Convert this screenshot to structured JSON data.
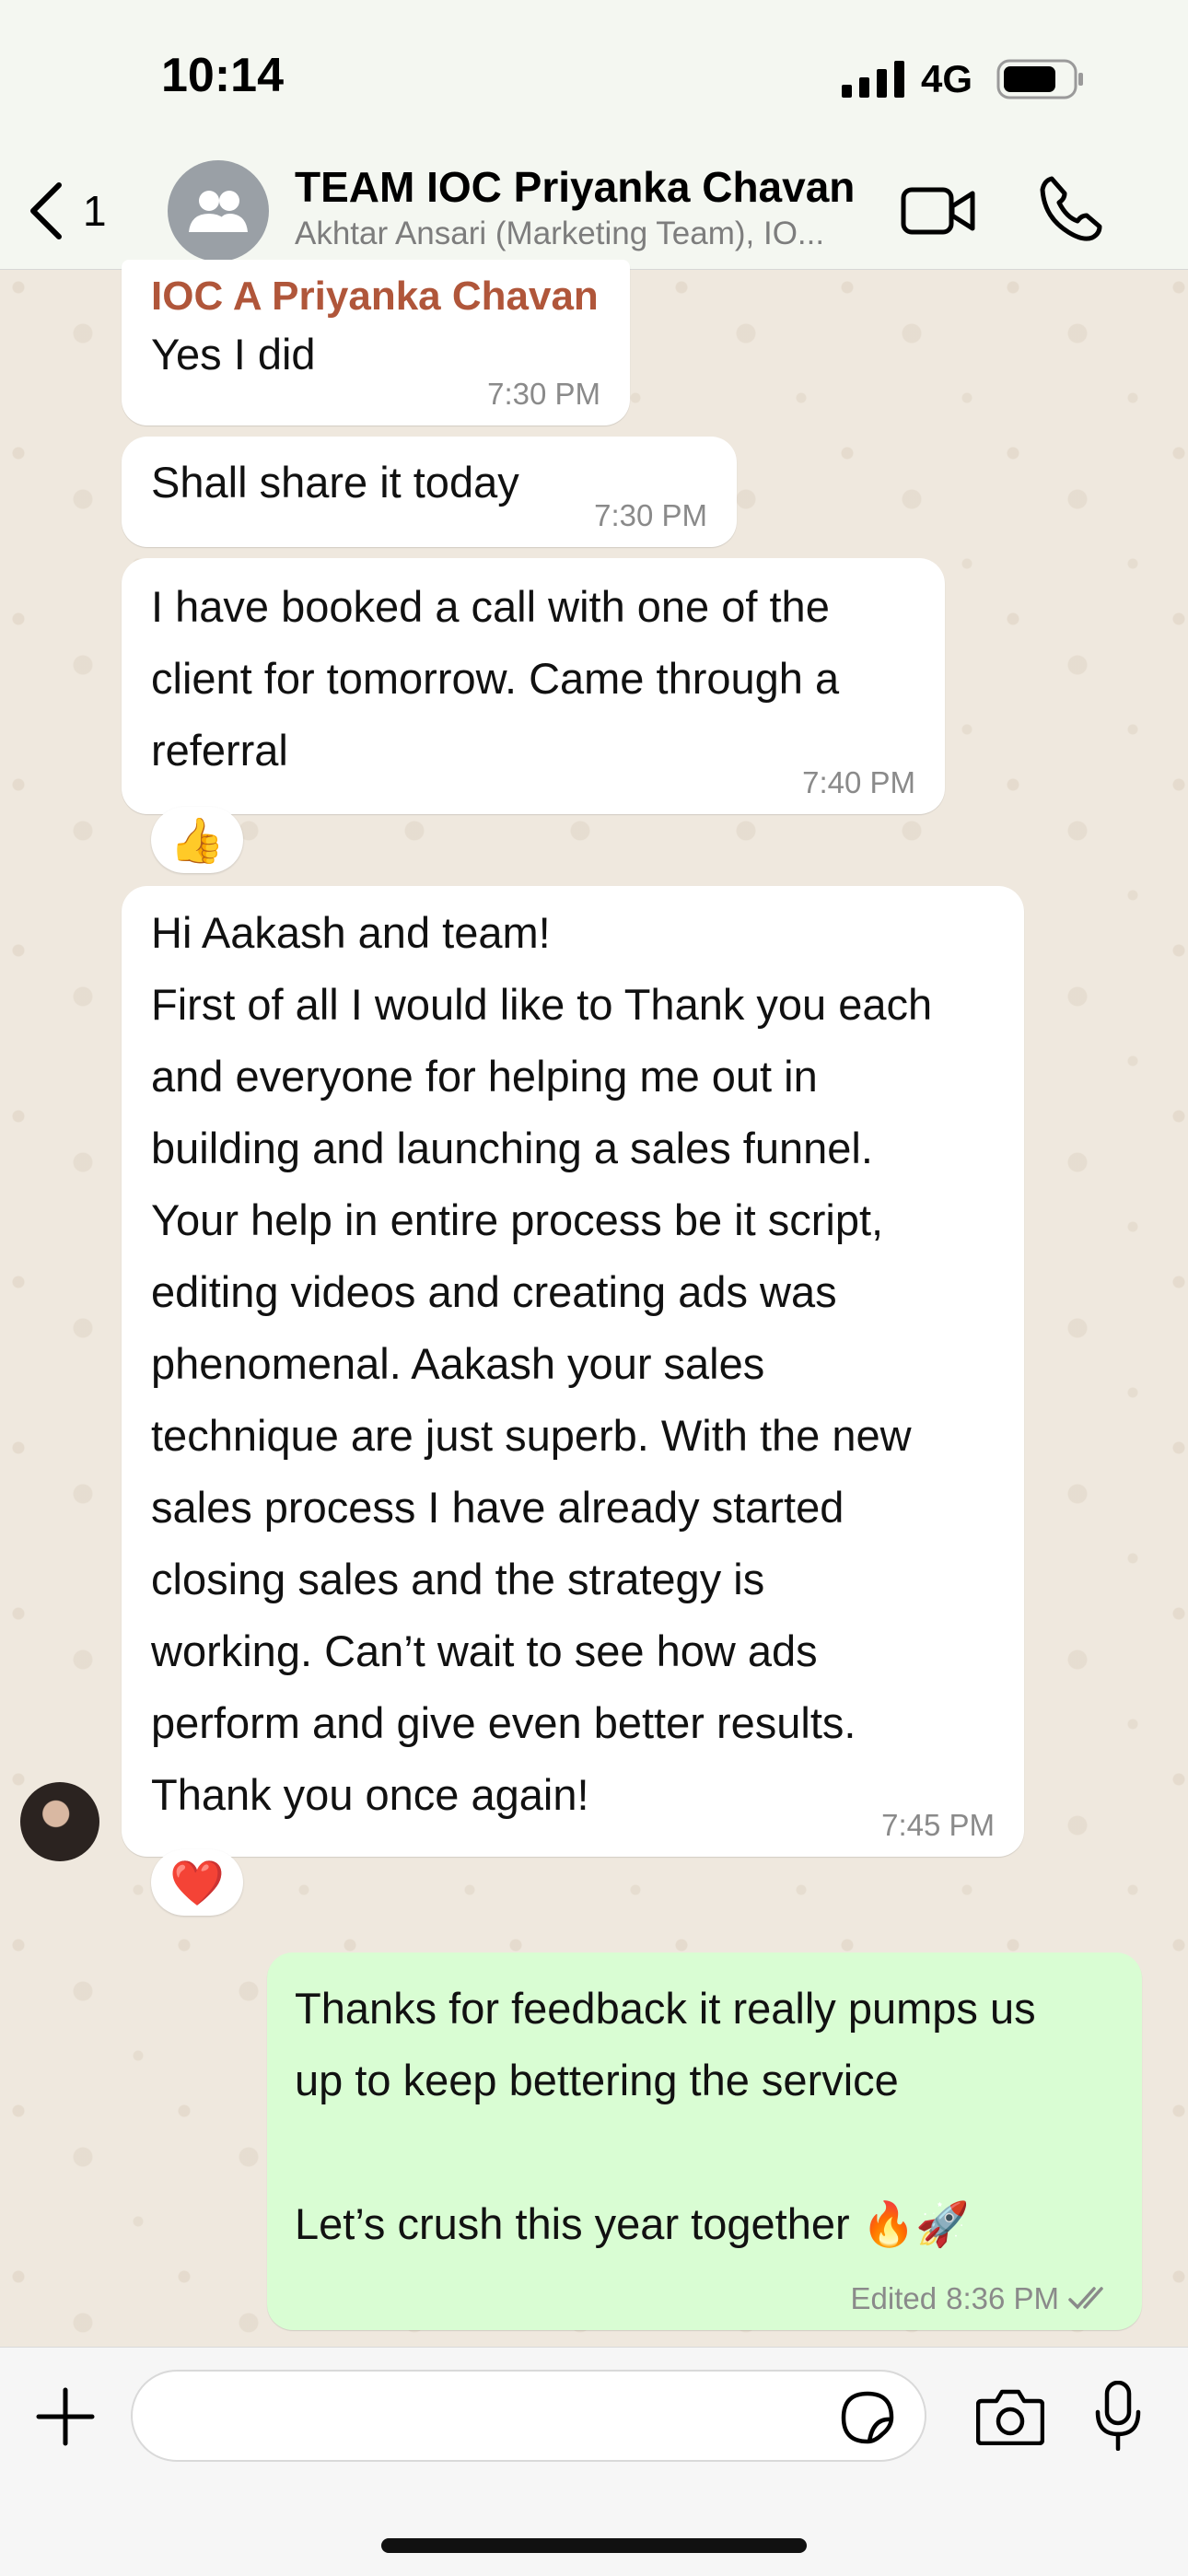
{
  "status_bar": {
    "time": "10:14",
    "network": "4G"
  },
  "header": {
    "back_count": "1",
    "title": "TEAM IOC Priyanka Chavan",
    "subtitle": "Akhtar Ansari (Marketing Team), IO..."
  },
  "messages": [
    {
      "sender": "IOC A Priyanka Chavan",
      "text": "Yes I did",
      "time": "7:30 PM"
    },
    {
      "text": "Shall share it today",
      "time": "7:30 PM"
    },
    {
      "text": "I have booked a call with one of the\nclient for tomorrow. Came through a\nreferral",
      "time": "7:40 PM",
      "reaction": "👍"
    },
    {
      "text": "Hi Aakash and team!\nFirst of all I would like to Thank you each\nand everyone for helping me out in\nbuilding and launching a sales funnel.\nYour help in entire process be it script,\nediting videos and creating ads was\nphenomenal. Aakash your sales\ntechnique are just superb. With the new\nsales process I have already started\nclosing sales and the strategy is\nworking. Can’t wait to see how ads\nperform and give even better results.\nThank you once again!",
      "time": "7:45 PM",
      "reaction": "❤️"
    },
    {
      "text": "Thanks for feedback it really pumps us\nup to keep bettering the service\n\nLet’s crush this year together 🔥🚀",
      "edited": "Edited",
      "time": "8:36 PM",
      "outgoing": true
    }
  ],
  "input": {
    "placeholder": ""
  },
  "colors": {
    "outgoing_bubble": "#d9fdd3",
    "sender_name": "#b0563a",
    "read_ticks": "#8a8a8a"
  },
  "icons": [
    "chevron-left-icon",
    "group-icon",
    "video-call-icon",
    "phone-icon",
    "plus-icon",
    "sticker-icon",
    "camera-icon",
    "mic-icon"
  ]
}
